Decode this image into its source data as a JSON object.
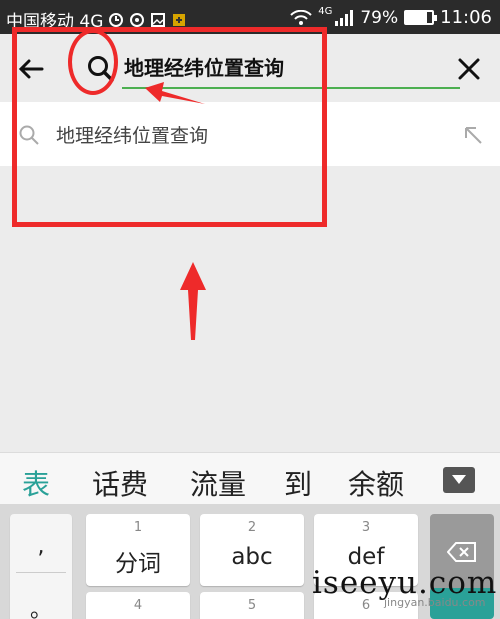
{
  "status_bar": {
    "carrier": "中国移动 4G",
    "network_tag": "4G",
    "battery_percent": "79%",
    "battery_level": 0.79,
    "time": "11:06"
  },
  "search": {
    "query": "地理经纬位置查询",
    "accent_color": "#4caf50",
    "icons": [
      "back-arrow-icon",
      "search-icon",
      "close-icon"
    ]
  },
  "suggestion": {
    "text": "地理经纬位置查询",
    "icons": [
      "search-icon",
      "fill-arrow-icon"
    ]
  },
  "annotation": {
    "color": "#ee2a2a"
  },
  "candidates": {
    "items": [
      "表",
      "话费",
      "流量",
      "到",
      "余额"
    ],
    "active_color": "#2aa198"
  },
  "keyboard": {
    "punct": [
      ",",
      "。"
    ],
    "keys": [
      {
        "num": "1",
        "label": "分词"
      },
      {
        "num": "2",
        "label": "abc"
      },
      {
        "num": "3",
        "label": "def"
      },
      {
        "num": "4",
        "label": ""
      },
      {
        "num": "5",
        "label": ""
      },
      {
        "num": "6",
        "label": ""
      }
    ],
    "enter_color": "#2aa198"
  },
  "watermark": {
    "text": "iseeyu.com",
    "small": "jingyan.baidu.com"
  }
}
